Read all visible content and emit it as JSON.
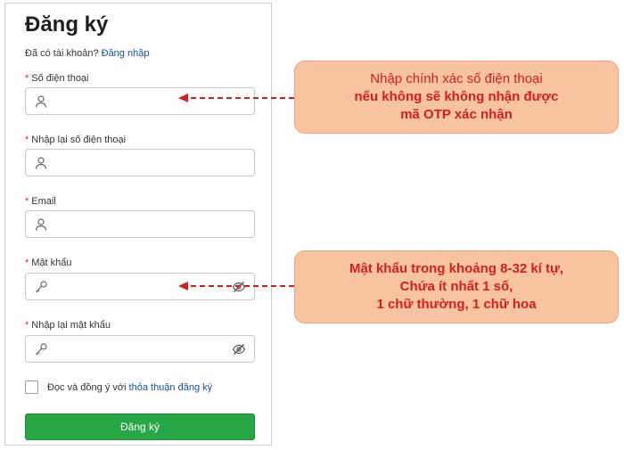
{
  "form": {
    "title": "Đăng ký",
    "login_prompt": "Đã có tài khoản?",
    "login_link": "Đăng nhập",
    "fields": [
      {
        "label": "Số điện thoại",
        "icon": "user-icon",
        "required": true
      },
      {
        "label": "Nhập lại số điện thoại",
        "icon": "user-icon",
        "required": true
      },
      {
        "label": "Email",
        "icon": "user-icon",
        "required": true
      },
      {
        "label": "Mật khẩu",
        "icon": "key-icon",
        "required": true,
        "trailing_icon": "eye-slash-icon"
      },
      {
        "label": "Nhập lại mật khẩu",
        "icon": "key-icon",
        "required": true,
        "trailing_icon": "eye-slash-icon"
      }
    ],
    "required_mark": "*",
    "terms_text": "Đọc và đồng ý với",
    "terms_link": "thỏa thuận đăng ký",
    "submit_label": "Đăng ký"
  },
  "callouts": {
    "phone": {
      "line1": "Nhập chính xác số điện thoại",
      "line2": "nếu không sẽ không nhận được",
      "line3": "mã OTP xác nhận"
    },
    "password": {
      "line1": "Mật khẩu trong khoảng 8-32 kí tự,",
      "line2": "Chứa ít nhất 1 số,",
      "line3": "1 chữ thường, 1 chữ hoa"
    }
  },
  "colors": {
    "callout_bg": "#f8c3a0",
    "callout_text": "#d31f1f",
    "arrow": "#d31f1f",
    "submit_bg": "#27a745",
    "link": "#1a4fa0"
  }
}
